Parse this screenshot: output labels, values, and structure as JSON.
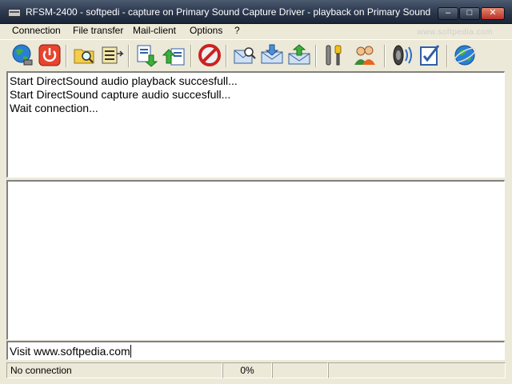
{
  "window": {
    "title": "RFSM-2400 - softpedi - capture on Primary Sound Capture Driver - playback on Primary Sound ...",
    "watermark": "www.softpedia.com",
    "min_glyph": "–",
    "max_glyph": "□",
    "close_glyph": "✕"
  },
  "menu": {
    "items": [
      "Connection",
      "File transfer",
      "Mail-client",
      "Options",
      "?"
    ]
  },
  "toolbar": {
    "buttons": [
      "globe-connect-icon",
      "power-icon",
      "open-folder-icon",
      "file-list-icon",
      "download-file-icon",
      "upload-file-icon",
      "stop-icon",
      "mail-search-icon",
      "mail-receive-icon",
      "mail-send-icon",
      "tools-icon",
      "users-icon",
      "speaker-icon",
      "checklist-icon",
      "internet-icon"
    ]
  },
  "log": {
    "lines": [
      "Start DirectSound audio playback succesfull...",
      "Start DirectSound capture audio succesfull...",
      "Wait connection..."
    ]
  },
  "input": {
    "value": "Visit www.softpedia.com"
  },
  "status": {
    "connection": "No connection",
    "progress": "0%",
    "cell3": "",
    "cell4": ""
  },
  "colors": {
    "titlebar": "#2f3c52",
    "close_button": "#c9463a",
    "panel": "#ece9d8"
  }
}
